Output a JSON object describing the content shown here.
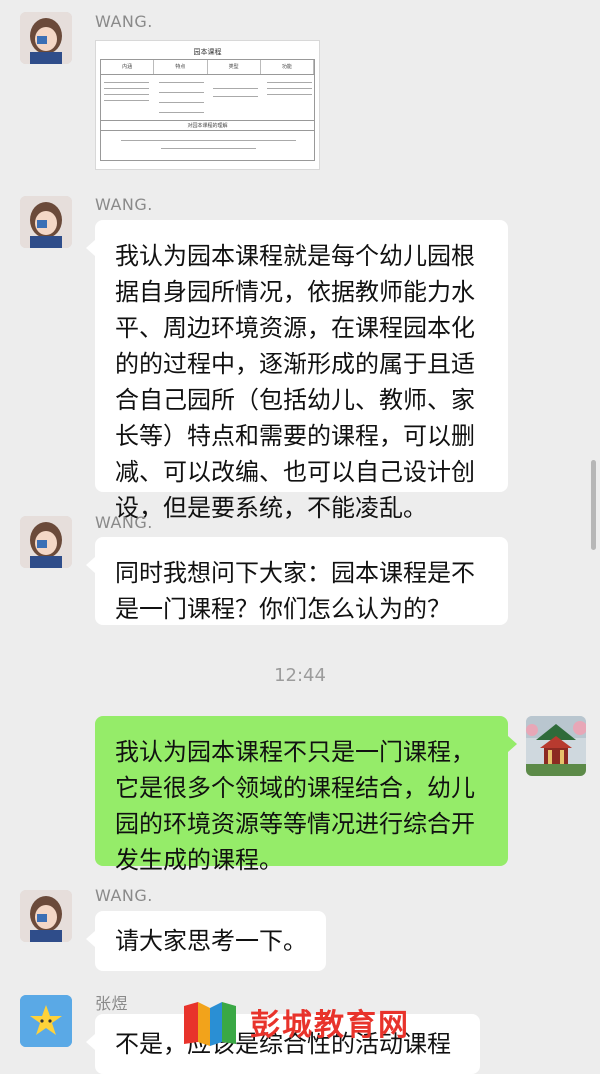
{
  "chat": {
    "messages": [
      {
        "sender": "WANG.",
        "type": "image",
        "image": {
          "title": "园本课程",
          "headers": [
            "内涵",
            "特点",
            "类型",
            "功能"
          ],
          "subtitle": "对园本课程的理解"
        }
      },
      {
        "sender": "WANG.",
        "type": "text",
        "text": "我认为园本课程就是每个幼儿园根据自身园所情况，依据教师能力水平、周边环境资源，在课程园本化的的过程中，逐渐形成的属于且适合自己园所（包括幼儿、教师、家长等）特点和需要的课程，可以删减、可以改编、也可以自己设计创设，但是要系统，不能凌乱。"
      },
      {
        "sender": "WANG.",
        "type": "text",
        "text": "同时我想问下大家：园本课程是不是一门课程？你们怎么认为的？"
      },
      {
        "type": "timestamp",
        "text": "12:44"
      },
      {
        "sender": "me",
        "type": "text",
        "text": "我认为园本课程不只是一门课程，它是很多个领域的课程结合，幼儿园的环境资源等等情况进行综合开发生成的课程。"
      },
      {
        "sender": "WANG.",
        "type": "text",
        "text": "请大家思考一下。"
      },
      {
        "sender": "张煜",
        "type": "text",
        "text": "不是，应该是综合性的活动课程"
      }
    ]
  },
  "watermark": {
    "text": "彭城教育网"
  },
  "colors": {
    "background": "#ededed",
    "bubble_left": "#ffffff",
    "bubble_right": "#95ec69",
    "watermark": "#e8332b"
  }
}
